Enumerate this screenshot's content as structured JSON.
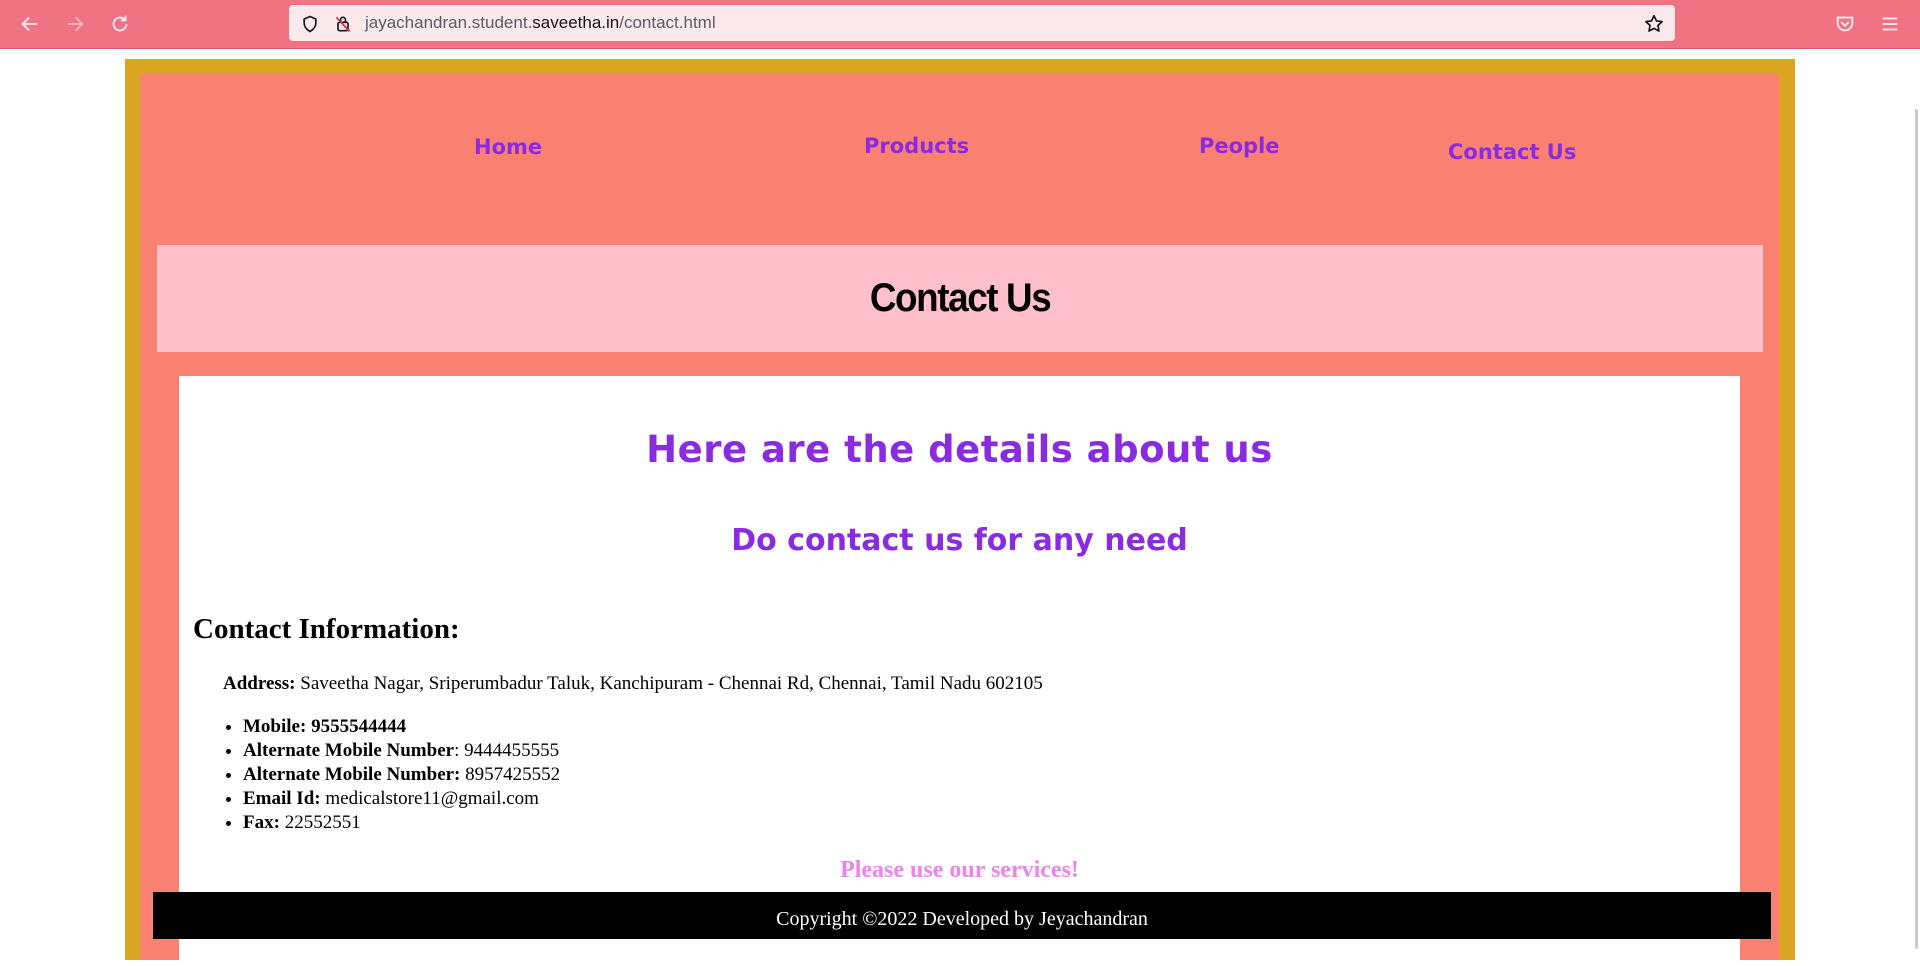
{
  "browser": {
    "url_prefix": "jayachandran.student.",
    "url_host": "saveetha.in",
    "url_path": "/contact.html",
    "icons": [
      "back-arrow-icon",
      "forward-arrow-icon",
      "reload-icon",
      "shield-icon",
      "permissions-icon",
      "bookmark-star-icon",
      "pocket-icon",
      "menu-icon"
    ]
  },
  "nav": {
    "home": "Home",
    "products": "Products",
    "people": "People",
    "contact": "Contact Us"
  },
  "banner": {
    "title": "Contact Us"
  },
  "content": {
    "heading": "Here are the details about us",
    "subheading": "Do contact us for any need",
    "info_title": "Contact Information:",
    "address_label": "Address:",
    "address_value": " Saveetha Nagar, Sriperumbadur Taluk, Kanchipuram - Chennai Rd, Chennai, Tamil Nadu 602105",
    "details": [
      {
        "label": "Mobile: 9555544444",
        "value": ""
      },
      {
        "label": "Alternate Mobile Number",
        "value": ": 9444455555"
      },
      {
        "label": "Alternate Mobile Number:",
        "value": " 8957425552"
      },
      {
        "label": "Email Id:",
        "value": " medicalstore11@gmail.com"
      },
      {
        "label": "Fax:",
        "value": " 22552551"
      }
    ],
    "closing": "Please use our services!"
  },
  "footer": {
    "text": "Copyright ©2022 Developed by Jeyachandran"
  },
  "colors": {
    "chrome": "#ef7382",
    "frame_border": "#daa520",
    "page_bg": "#fa8072",
    "banner_bg": "#ffc0cb",
    "link": "#8a2be2",
    "closing_text": "#ee82ee",
    "footer_bg": "#000000"
  }
}
